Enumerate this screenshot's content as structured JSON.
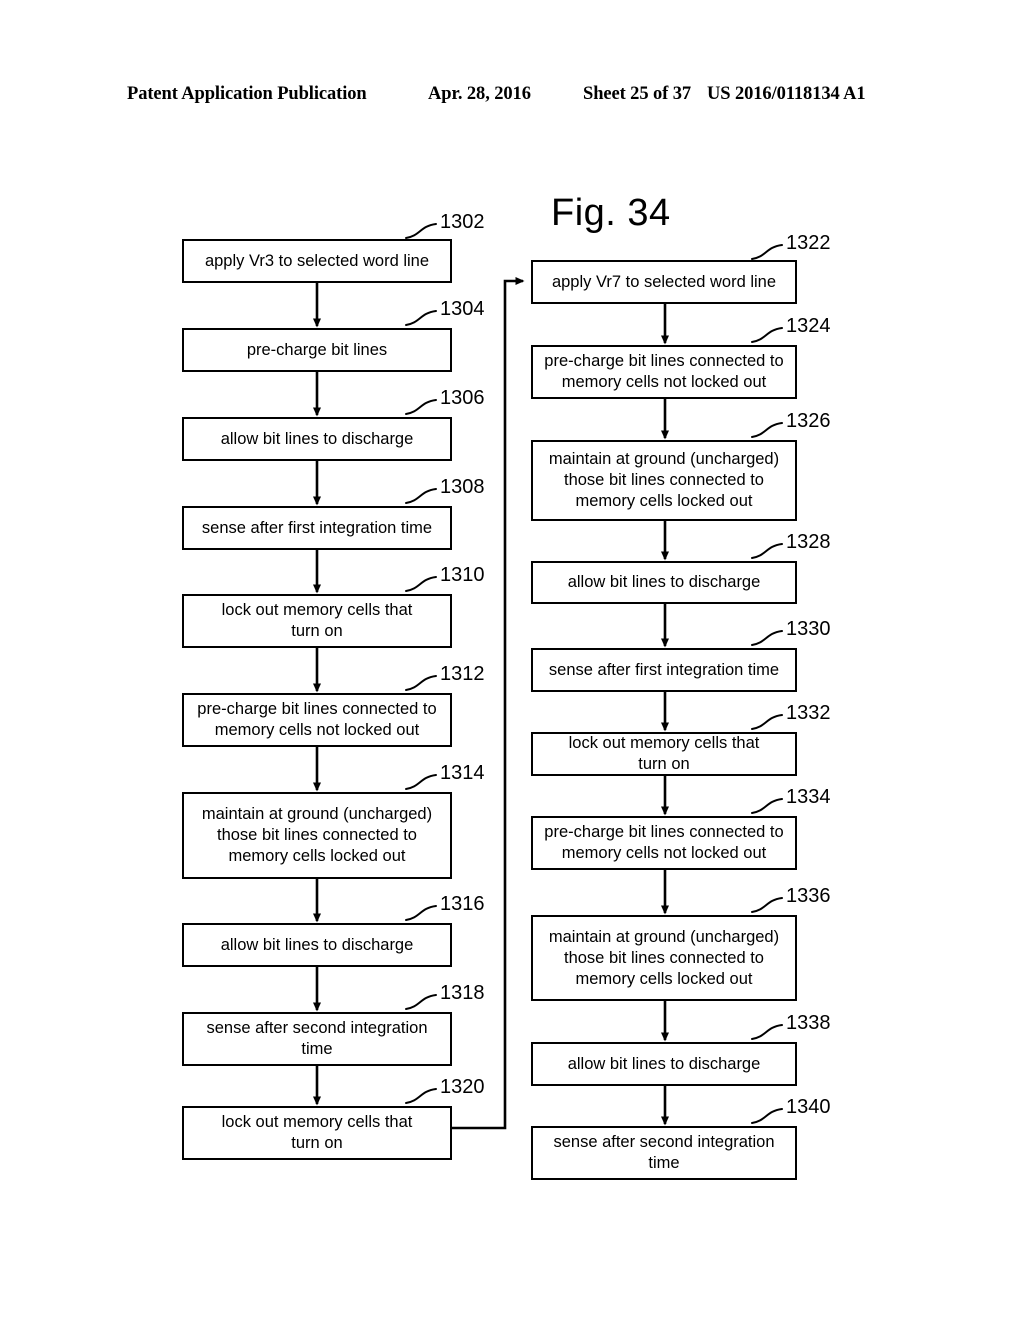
{
  "header": {
    "publication": "Patent Application Publication",
    "date": "Apr. 28, 2016",
    "sheet": "Sheet 25 of 37",
    "patent_number": "US 2016/0118134 A1"
  },
  "figure": {
    "title": "Fig. 34"
  },
  "flowchart": {
    "left_column": [
      {
        "ref": "1302",
        "text": "apply Vr3 to selected word line"
      },
      {
        "ref": "1304",
        "text": "pre-charge bit lines"
      },
      {
        "ref": "1306",
        "text": "allow bit lines to discharge"
      },
      {
        "ref": "1308",
        "text": "sense after first integration time"
      },
      {
        "ref": "1310",
        "text": "lock out memory cells that\nturn on"
      },
      {
        "ref": "1312",
        "text": "pre-charge bit lines connected to\nmemory cells not locked out"
      },
      {
        "ref": "1314",
        "text": "maintain at ground (uncharged)\nthose bit lines connected to\nmemory cells locked out"
      },
      {
        "ref": "1316",
        "text": "allow bit lines to discharge"
      },
      {
        "ref": "1318",
        "text": "sense after second integration\ntime"
      },
      {
        "ref": "1320",
        "text": "lock out memory cells that\nturn on"
      }
    ],
    "right_column": [
      {
        "ref": "1322",
        "text": "apply Vr7 to selected word line"
      },
      {
        "ref": "1324",
        "text": "pre-charge bit lines connected to\nmemory cells not locked out"
      },
      {
        "ref": "1326",
        "text": "maintain at ground (uncharged)\nthose bit lines connected to\nmemory cells locked out"
      },
      {
        "ref": "1328",
        "text": "allow bit lines to discharge"
      },
      {
        "ref": "1330",
        "text": "sense after first integration time"
      },
      {
        "ref": "1332",
        "text": "lock out memory cells that\nturn on"
      },
      {
        "ref": "1334",
        "text": "pre-charge bit lines connected to\nmemory cells not locked out"
      },
      {
        "ref": "1336",
        "text": "maintain at ground (uncharged)\nthose bit lines connected to\nmemory cells locked out"
      },
      {
        "ref": "1338",
        "text": "allow bit lines to discharge"
      },
      {
        "ref": "1340",
        "text": "sense after second integration\ntime"
      }
    ]
  }
}
